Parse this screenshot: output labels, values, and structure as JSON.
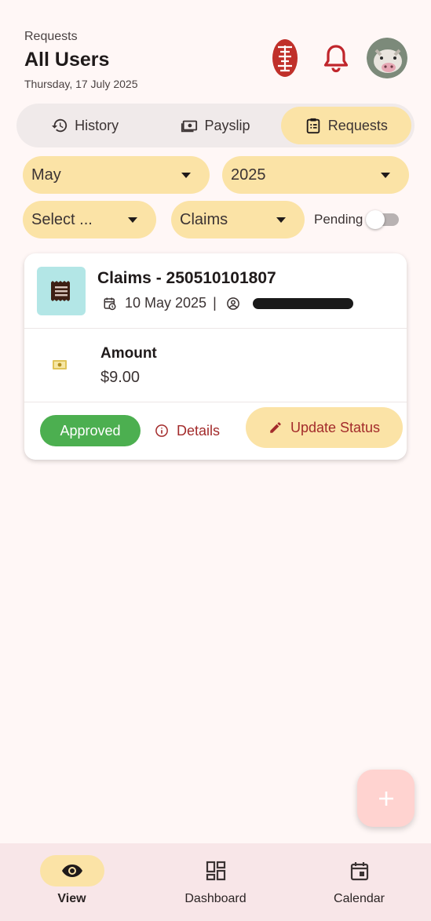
{
  "header": {
    "breadcrumb": "Requests",
    "title": "All Users",
    "date": "Thursday, 17 July 2025",
    "icons": [
      "seal-logo-icon",
      "bell-icon",
      "avatar"
    ]
  },
  "tabs": [
    {
      "label": "History",
      "icon": "history-icon",
      "active": false
    },
    {
      "label": "Payslip",
      "icon": "payslip-icon",
      "active": false
    },
    {
      "label": "Requests",
      "icon": "requests-clipboard-icon",
      "active": true
    }
  ],
  "filters": {
    "month": "May",
    "year": "2025",
    "user": "Select ...",
    "type": "Claims",
    "pending_label": "Pending",
    "pending_on": false
  },
  "request_card": {
    "title": "Claims - 250510101807",
    "date": "10 May 2025",
    "separator": "|",
    "amount_label": "Amount",
    "amount_value": "$9.00",
    "status": "Approved",
    "details_label": "Details",
    "update_label": "Update Status"
  },
  "fab": {
    "icon": "plus-icon"
  },
  "bottom_nav": [
    {
      "label": "View",
      "icon": "eye-icon",
      "active": true
    },
    {
      "label": "Dashboard",
      "icon": "dashboard-icon",
      "active": false
    },
    {
      "label": "Calendar",
      "icon": "calendar-icon",
      "active": false
    }
  ],
  "colors": {
    "accent": "#fbe3a6",
    "status_approved": "#4caf50",
    "action_text": "#a32b2b",
    "background": "#fff7f6",
    "nav_background": "#f8e6e8"
  }
}
